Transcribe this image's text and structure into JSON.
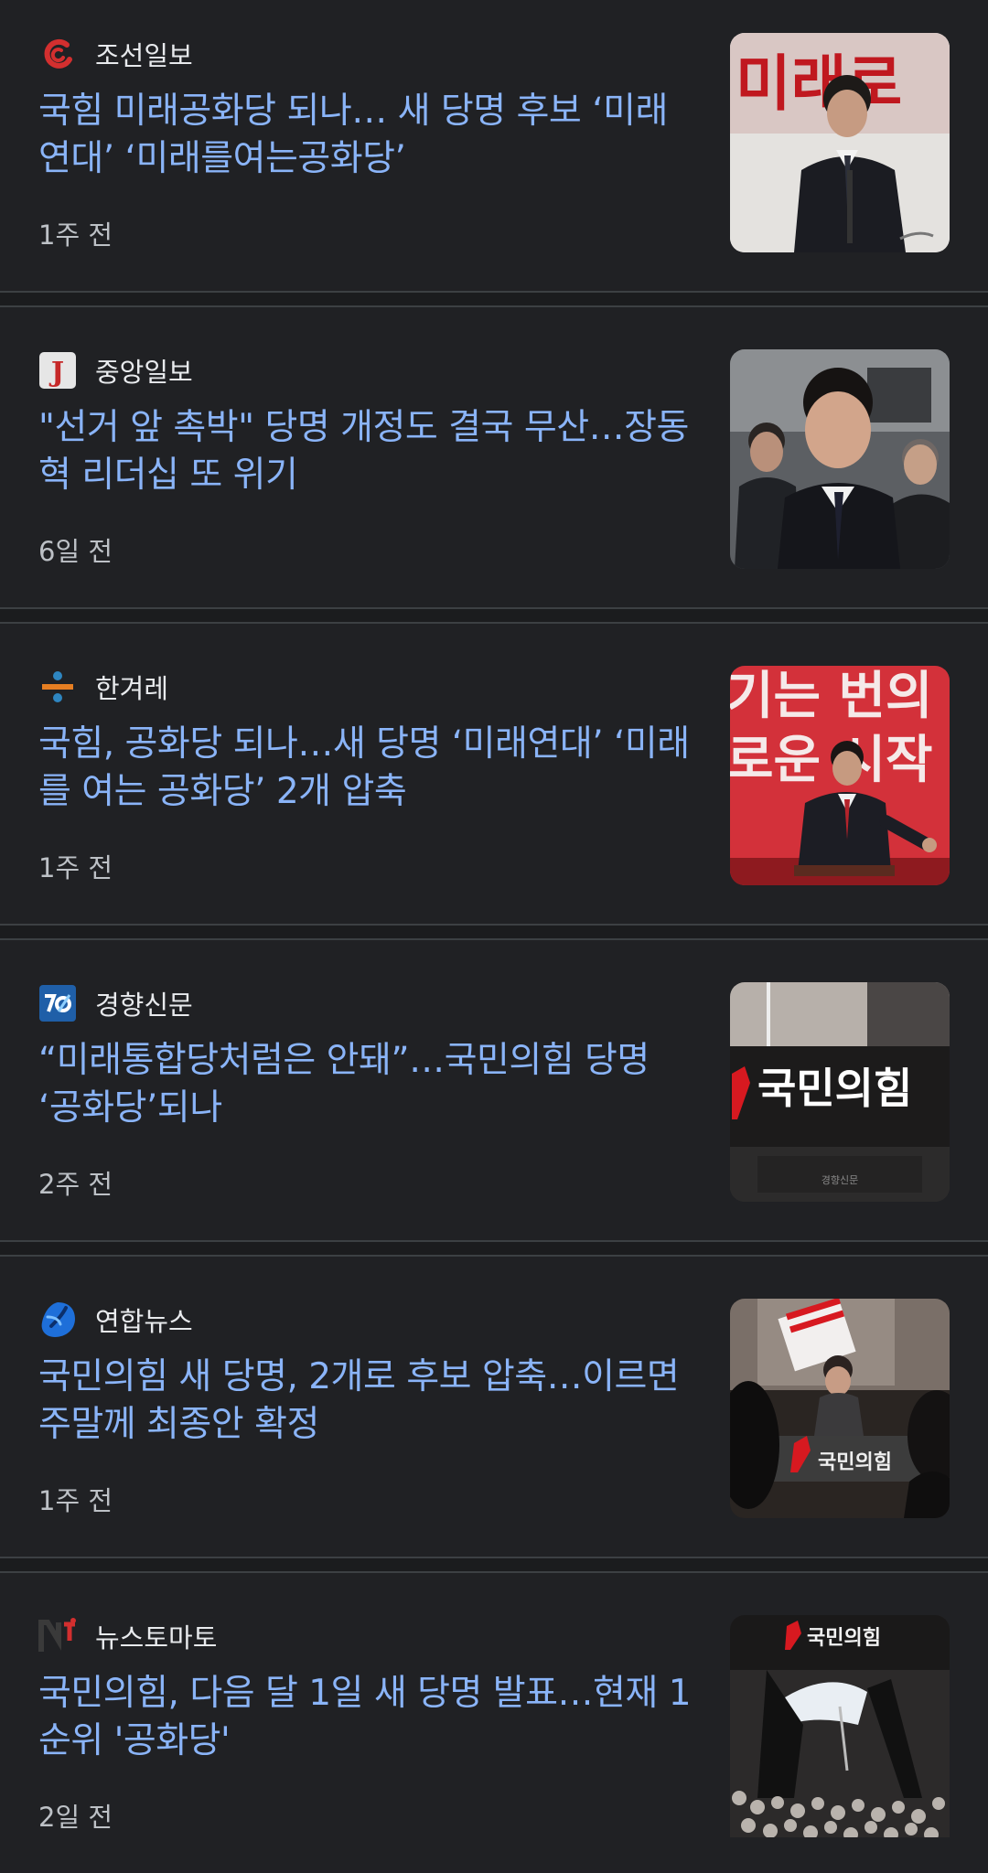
{
  "articles": [
    {
      "source": "조선일보",
      "logo_icon": "chosun-logo-icon",
      "headline": "국힘 미래공화당 되나… 새 당명 후보 ‘미래연대’ ‘미래를여는공화당’",
      "time": "1주 전"
    },
    {
      "source": "중앙일보",
      "logo_icon": "joongang-logo-icon",
      "headline": "\"선거 앞 촉박\" 당명 개정도 결국 무산…장동혁 리더십 또 위기",
      "time": "6일 전"
    },
    {
      "source": "한겨레",
      "logo_icon": "hani-logo-icon",
      "headline": "국힘, 공화당 되나…새 당명 ‘미래연대’ ‘미래를 여는 공화당’ 2개 압축",
      "time": "1주 전"
    },
    {
      "source": "경향신문",
      "logo_icon": "khan-logo-icon",
      "headline": "“미래통합당처럼은 안돼”…국민의힘 당명 ‘공화당’되나",
      "time": "2주 전"
    },
    {
      "source": "연합뉴스",
      "logo_icon": "yonhap-logo-icon",
      "headline": "국민의힘 새 당명, 2개로 후보 압축…이르면 주말께 최종안 확정",
      "time": "1주 전"
    },
    {
      "source": "뉴스토마토",
      "logo_icon": "newstomato-logo-icon",
      "headline": "국민의힘, 다음 달 1일 새 당명 발표…현재 1순위 '공화당'",
      "time": "2일 전"
    }
  ],
  "thumbnails": {
    "t1_sign": "미래로",
    "t3_sign_top": "기는 번의",
    "t3_sign_bottom": "로운 시작",
    "t4_sign": "국민의힘",
    "t4_small": "경향신문",
    "t5_sign": "국민의힘",
    "t6_sign": "국민의힘"
  },
  "colors": {
    "background": "#202124",
    "headline": "#8ab4f8",
    "source": "#e8eaed",
    "time": "#bdc1c6",
    "divider": "#3c4043"
  }
}
